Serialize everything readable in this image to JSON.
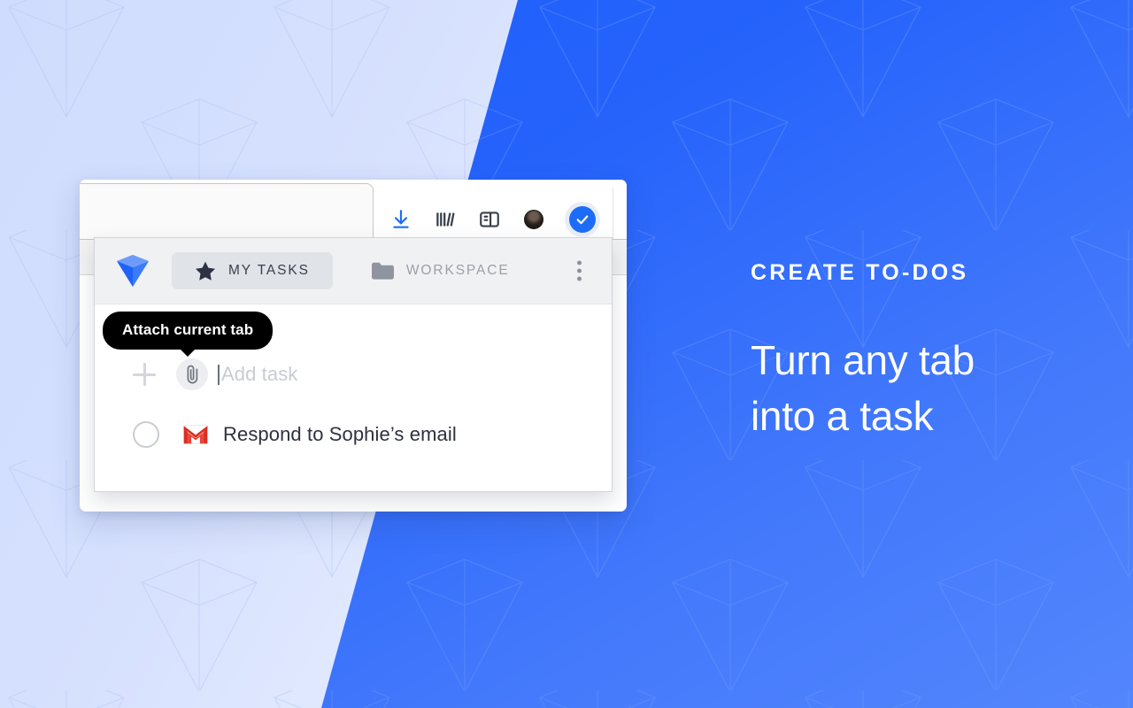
{
  "promo": {
    "eyebrow": "CREATE TO-DOS",
    "headline_line1": "Turn any tab",
    "headline_line2": "into a task",
    "accent_color": "#1d5ffa",
    "light_bg_color": "#d6e1fe"
  },
  "browser": {
    "tab_title": "",
    "toolbar_icons": [
      {
        "name": "download-icon",
        "color": "#1c6cf7"
      },
      {
        "name": "library-icon",
        "color": "#3a3f4a"
      },
      {
        "name": "sidebar-icon",
        "color": "#3a3f4a"
      },
      {
        "name": "account-avatar",
        "color": "#2a211c"
      },
      {
        "name": "taskade-extension-check-icon",
        "color": "#1c6cf7"
      }
    ]
  },
  "popup": {
    "logo_name": "taskade-logo",
    "tabs": [
      {
        "label": "MY TASKS",
        "icon": "star-icon",
        "active": true
      },
      {
        "label": "WORKSPACE",
        "icon": "folder-icon",
        "active": false
      }
    ],
    "menu_icon": "kebab-menu-icon",
    "tooltip": "Attach current tab",
    "add_task": {
      "placeholder": "Add task",
      "plus_icon": "plus-icon",
      "attach_icon": "paperclip-icon"
    },
    "tasks": [
      {
        "text": "Respond to Sophie’s email",
        "source_icon": "gmail-icon",
        "completed": false
      }
    ]
  }
}
